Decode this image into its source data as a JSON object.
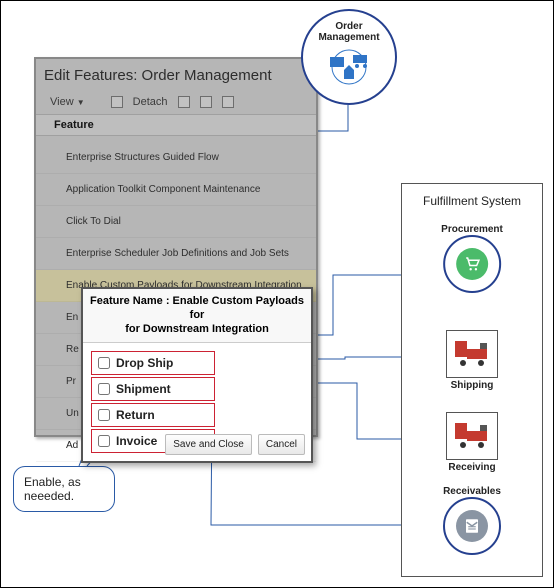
{
  "panel": {
    "title": "Edit Features: Order Management",
    "view_label": "View",
    "detach_label": "Detach",
    "column_header": "Feature",
    "rows": [
      "Enterprise Structures Guided Flow",
      "Application Toolkit Component Maintenance",
      "Click To Dial",
      "Enterprise Scheduler Job Definitions and Job Sets",
      "Enable Custom Payloads for Downstream Integration",
      "En",
      "Re",
      "Pr",
      "Un",
      "Ad"
    ]
  },
  "dialog": {
    "title_l1": "Feature Name : Enable Custom Payloads for",
    "title_l2": "for Downstream Integration",
    "options": [
      "Drop Ship",
      "Shipment",
      "Return",
      "Invoice"
    ],
    "save_label": "Save and Close",
    "cancel_label": "Cancel"
  },
  "callout": {
    "line1": "Enable, as",
    "line2": "neeeded."
  },
  "om_badge": {
    "line1": "Order",
    "line2": "Management"
  },
  "fulfillment": {
    "title": "Fulfillment System",
    "nodes": {
      "procurement": "Procurement",
      "shipping": "Shipping",
      "receiving": "Receiving",
      "receivables": "Receivables"
    }
  },
  "colors": {
    "navy": "#25408f",
    "blue": "#2f74c6",
    "green": "#4bbb6a",
    "red": "#c43a2f",
    "grayInk": "#8a95a3"
  }
}
